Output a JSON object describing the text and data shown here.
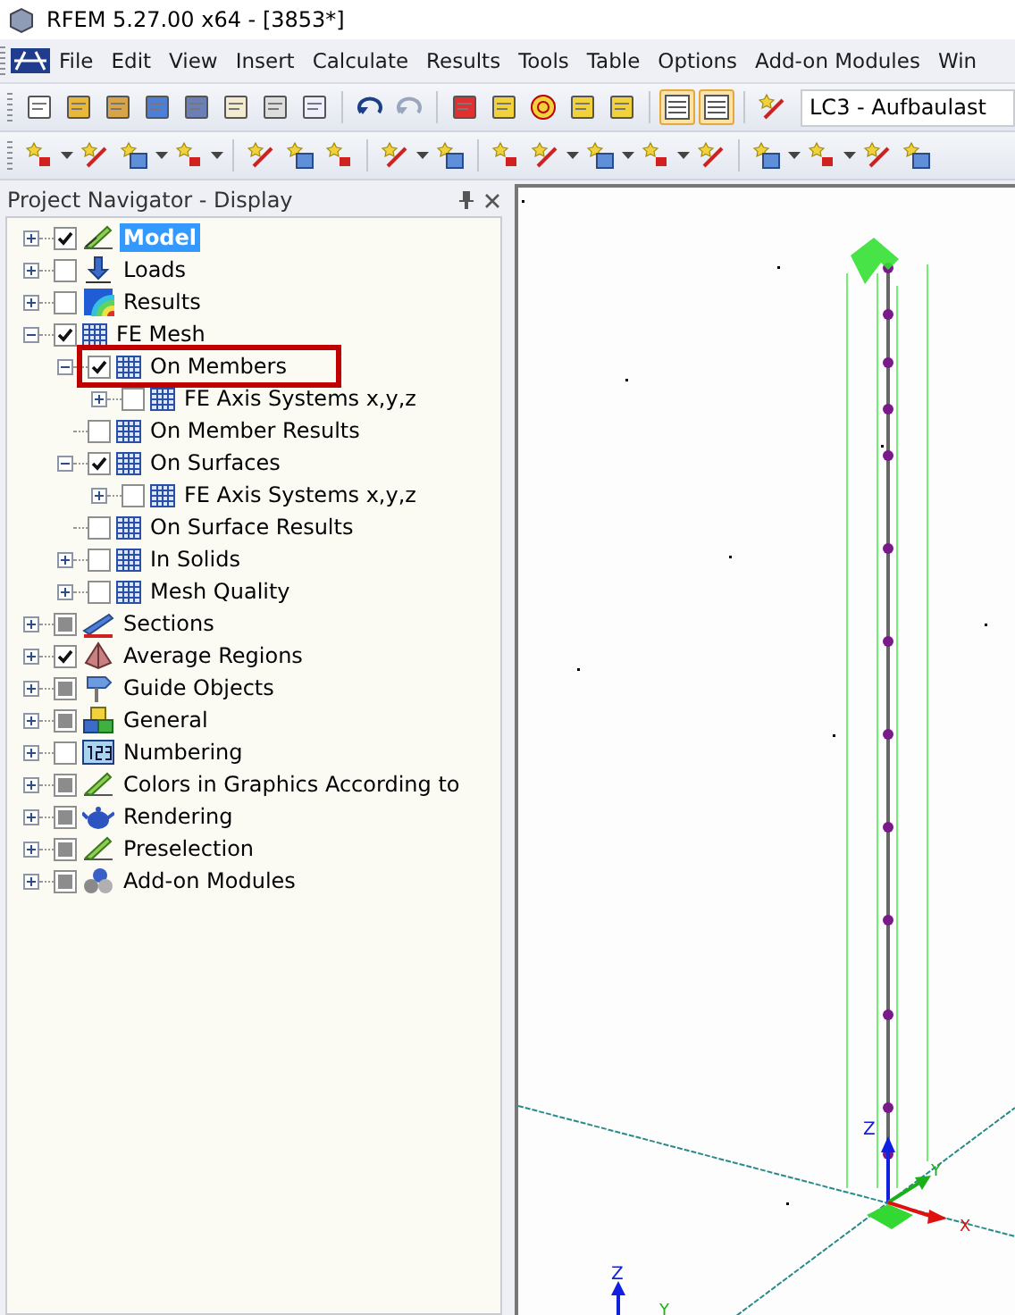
{
  "window": {
    "title": "RFEM 5.27.00 x64 - [3853*]"
  },
  "menu": [
    "File",
    "Edit",
    "View",
    "Insert",
    "Calculate",
    "Results",
    "Tools",
    "Table",
    "Options",
    "Add-on Modules",
    "Win"
  ],
  "toolbar_1": {
    "buttons": [
      {
        "pressed": false
      },
      {
        "pressed": false
      },
      {
        "pressed": false
      },
      {
        "pressed": false
      },
      {
        "pressed": false
      },
      {
        "pressed": false
      },
      {
        "pressed": false
      },
      {
        "pressed": false
      },
      {
        "pressed": false
      },
      {
        "pressed": false
      },
      {
        "pressed": false
      },
      {
        "pressed": false
      },
      {
        "pressed": false
      },
      {
        "pressed": false
      },
      {
        "pressed": false
      },
      {
        "pressed": true
      },
      {
        "pressed": true
      }
    ],
    "load_case": "LC3 - Aufbaulast"
  },
  "navigator": {
    "title": "Project Navigator - Display",
    "items": [
      {
        "label": "Model",
        "checked": true,
        "mixed": false,
        "expanded": false,
        "selected": true
      },
      {
        "label": "Loads",
        "checked": false,
        "mixed": false,
        "expanded": false,
        "selected": false
      },
      {
        "label": "Results",
        "checked": false,
        "mixed": false,
        "expanded": false,
        "selected": false
      },
      {
        "label": "FE Mesh",
        "checked": true,
        "mixed": false,
        "expanded": true,
        "selected": false,
        "children": [
          {
            "label": "On Members",
            "checked": true,
            "mixed": false,
            "expanded": true,
            "selected": false,
            "highlighted": true,
            "children": [
              {
                "label": "FE Axis Systems x,y,z",
                "checked": false,
                "mixed": false,
                "expanded": false,
                "selected": false
              }
            ]
          },
          {
            "label": "On Member Results",
            "checked": false,
            "mixed": false,
            "selected": false
          },
          {
            "label": "On Surfaces",
            "checked": true,
            "mixed": false,
            "expanded": true,
            "selected": false,
            "children": [
              {
                "label": "FE Axis Systems x,y,z",
                "checked": false,
                "mixed": false,
                "expanded": false,
                "selected": false
              }
            ]
          },
          {
            "label": "On Surface Results",
            "checked": false,
            "mixed": false,
            "selected": false
          },
          {
            "label": "In Solids",
            "checked": false,
            "mixed": false,
            "expanded": false,
            "selected": false
          },
          {
            "label": "Mesh Quality",
            "checked": false,
            "mixed": false,
            "expanded": false,
            "selected": false
          }
        ]
      },
      {
        "label": "Sections",
        "checked": false,
        "mixed": true,
        "expanded": false,
        "selected": false
      },
      {
        "label": "Average Regions",
        "checked": true,
        "mixed": false,
        "expanded": false,
        "selected": false
      },
      {
        "label": "Guide Objects",
        "checked": false,
        "mixed": true,
        "expanded": false,
        "selected": false
      },
      {
        "label": "General",
        "checked": false,
        "mixed": true,
        "expanded": false,
        "selected": false
      },
      {
        "label": "Numbering",
        "checked": false,
        "mixed": false,
        "expanded": false,
        "selected": false
      },
      {
        "label": "Colors in Graphics According to",
        "checked": false,
        "mixed": true,
        "expanded": false,
        "selected": false
      },
      {
        "label": "Rendering",
        "checked": false,
        "mixed": true,
        "expanded": false,
        "selected": false
      },
      {
        "label": "Preselection",
        "checked": false,
        "mixed": true,
        "expanded": false,
        "selected": false
      },
      {
        "label": "Add-on Modules",
        "checked": false,
        "mixed": true,
        "expanded": false,
        "selected": false
      }
    ]
  },
  "viewport": {
    "axis_labels": [
      "Z",
      "Y",
      "X"
    ],
    "corner_axis_labels": [
      "Z",
      "Y"
    ]
  }
}
